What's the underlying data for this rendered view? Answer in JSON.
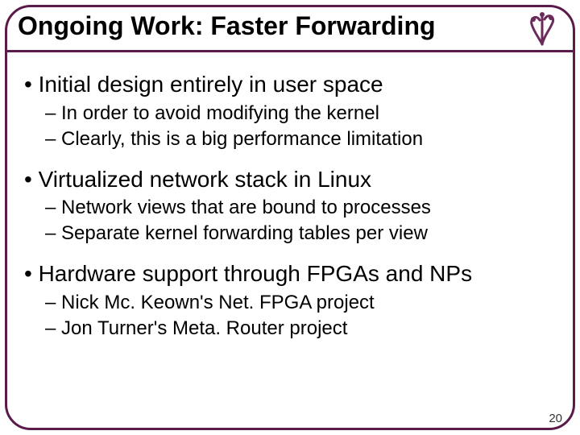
{
  "title": "Ongoing Work: Faster Forwarding",
  "page_number": "20",
  "bullets": [
    {
      "main": "• Initial design entirely in user space",
      "subs": [
        "– In order to avoid modifying the kernel",
        "– Clearly, this is a big performance limitation"
      ]
    },
    {
      "main": "• Virtualized network stack in Linux",
      "subs": [
        "– Network views that are bound to processes",
        "– Separate kernel forwarding tables per view"
      ]
    },
    {
      "main": "• Hardware support through FPGAs and NPs",
      "subs": [
        "– Nick Mc. Keown's Net. FPGA project",
        "– Jon Turner's Meta. Router project"
      ]
    }
  ]
}
